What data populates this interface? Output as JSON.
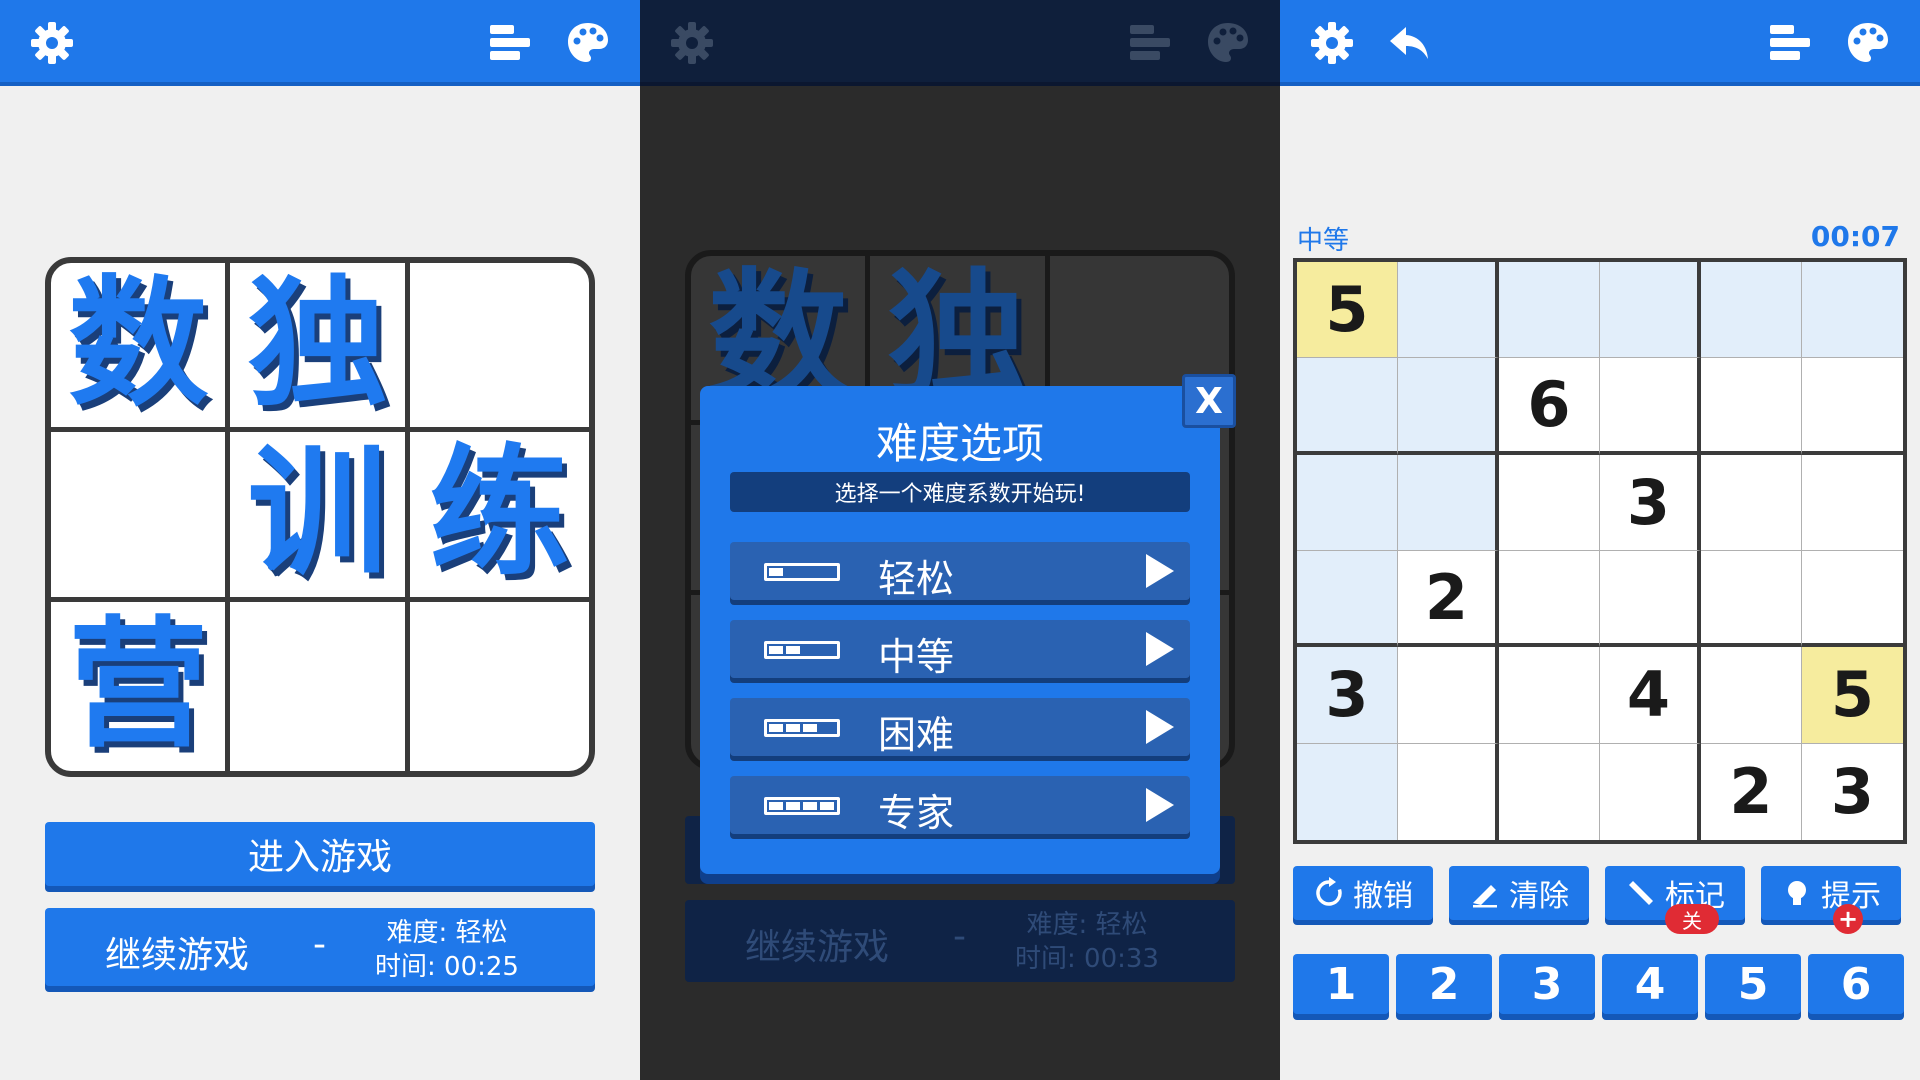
{
  "colors": {
    "accent": "#1f78ea",
    "accent_dark": "#1458b8",
    "highlight": "#e2eefa",
    "selected": "#f6ec9e",
    "badge": "#e02b34"
  },
  "icons": {
    "settings": "gear-icon",
    "stats": "bar-chart-icon",
    "theme": "palette-icon",
    "undo": "undo-arrow-icon"
  },
  "home": {
    "title_chars": [
      "数",
      "独",
      "",
      "",
      "训",
      "练",
      "营",
      "",
      ""
    ],
    "enter_label": "进入游戏",
    "continue_label": "继续游戏",
    "continue_dash": "-",
    "difficulty_text": "难度: 轻松",
    "time_text": "时间: 00:25"
  },
  "dialog": {
    "title": "难度选项",
    "close_label": "X",
    "subtitle": "选择一个难度系数开始玩!",
    "options": [
      {
        "label": "轻松",
        "level": 1
      },
      {
        "label": "中等",
        "level": 2
      },
      {
        "label": "困难",
        "level": 3
      },
      {
        "label": "专家",
        "level": 4
      }
    ],
    "bg_continue_label": "继续游戏",
    "bg_continue_dash": "-",
    "bg_difficulty_text": "难度: 轻松",
    "bg_time_text": "时间: 00:33"
  },
  "game": {
    "difficulty": "中等",
    "timer": "00:07",
    "grid": [
      [
        "5",
        "",
        "",
        "",
        "",
        ""
      ],
      [
        "",
        "",
        "6",
        "",
        "",
        ""
      ],
      [
        "",
        "",
        "",
        "3",
        "",
        ""
      ],
      [
        "",
        "2",
        "",
        "",
        "",
        ""
      ],
      [
        "3",
        "",
        "",
        "4",
        "",
        "5"
      ],
      [
        "",
        "",
        "",
        "",
        "2",
        "3"
      ]
    ],
    "highlighted_cells": [
      [
        0,
        1
      ],
      [
        0,
        2
      ],
      [
        0,
        3
      ],
      [
        0,
        4
      ],
      [
        0,
        5
      ],
      [
        1,
        0
      ],
      [
        1,
        1
      ],
      [
        2,
        0
      ],
      [
        2,
        1
      ],
      [
        3,
        0
      ],
      [
        4,
        0
      ],
      [
        5,
        0
      ]
    ],
    "selected_cells": [
      [
        0,
        0
      ],
      [
        4,
        5
      ]
    ],
    "tools": [
      {
        "label": "撤销",
        "icon": "refresh-icon"
      },
      {
        "label": "清除",
        "icon": "eraser-icon"
      },
      {
        "label": "标记",
        "icon": "pencil-icon",
        "badge": "关"
      },
      {
        "label": "提示",
        "icon": "lightbulb-icon",
        "badge": "+"
      }
    ],
    "numbers": [
      "1",
      "2",
      "3",
      "4",
      "5",
      "6"
    ]
  }
}
